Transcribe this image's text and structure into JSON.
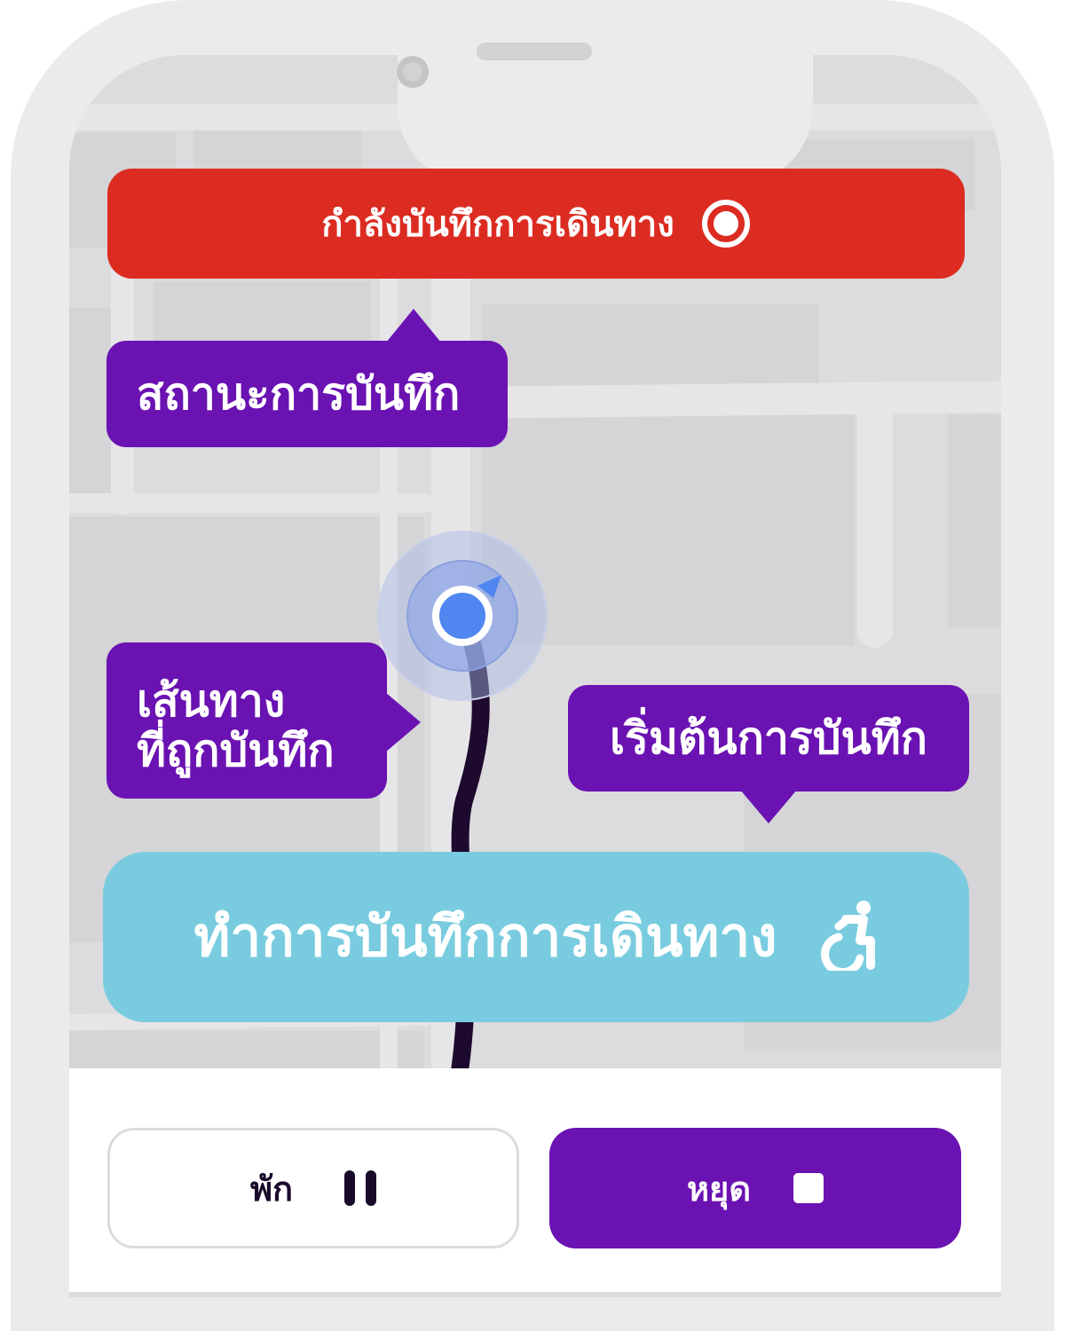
{
  "recording_banner": {
    "text": "กำลังบันทึกการเดินทาง",
    "icon": "record-dot-icon",
    "color": "#dc2c22"
  },
  "tooltips": {
    "status": "สถานะการบันทึก",
    "route_line1": "เส้นทาง",
    "route_line2": "ที่ถูกบันทึก",
    "start": "เริ่มต้นการบันทึก",
    "color": "#6a12b2"
  },
  "record_button": {
    "label": "ทำการบันทึกการเดินทาง",
    "icon": "wheelchair-icon",
    "color": "#79ccdf"
  },
  "controls": {
    "pause_label": "พัก",
    "pause_icon": "pause-icon",
    "stop_label": "หยุด",
    "stop_icon": "stop-icon"
  },
  "map": {
    "location_marker": "current-location",
    "route_color": "#1d0a2e",
    "marker_color": "#4f86f0"
  }
}
